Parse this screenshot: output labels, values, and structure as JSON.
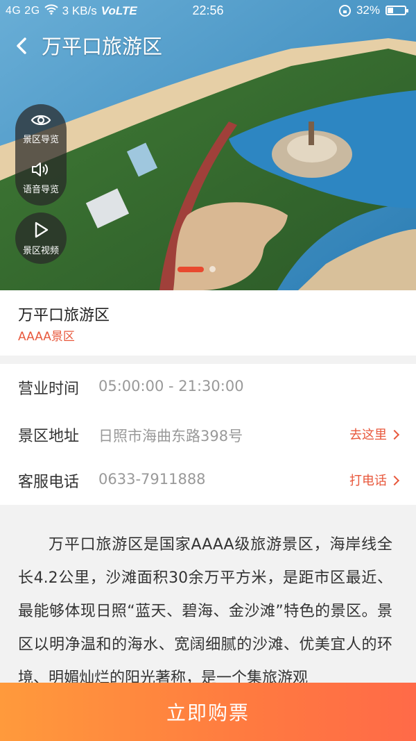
{
  "status": {
    "network": "4G 2G",
    "speed": "3 KB/s",
    "volte": "VoLTE",
    "time": "22:56",
    "battery": "32%",
    "battery_level": 0.32
  },
  "header": {
    "title": "万平口旅游区",
    "back_icon": "chevron-left-icon"
  },
  "side_menu": {
    "overview_label": "景区导览",
    "audio_label": "语音导览",
    "video_label": "景区视频"
  },
  "carousel": {
    "active_index": 0,
    "count": 2
  },
  "spot": {
    "name": "万平口旅游区",
    "level": "AAAA景区"
  },
  "info": {
    "hours_label": "营业时间",
    "hours_value": "05:00:00 - 21:30:00",
    "address_label": "景区地址",
    "address_value": "日照市海曲东路398号",
    "address_action": "去这里",
    "phone_label": "客服电话",
    "phone_value": "0633-7911888",
    "phone_action": "打电话"
  },
  "description": "万平口旅游区是国家AAAA级旅游景区，海岸线全长4.2公里，沙滩面积30余万平方米，是距市区最近、最能够体现日照“蓝天、碧海、金沙滩”特色的景区。景区以明净温和的海水、宽阔细腻的沙滩、优美宜人的环境、明媚灿烂的阳光著称，是一个集旅游观",
  "footer": {
    "buy_label": "立即购票"
  },
  "colors": {
    "accent": "#e8583c",
    "buy_start": "#ff9a3c",
    "buy_end": "#ff6a48"
  }
}
